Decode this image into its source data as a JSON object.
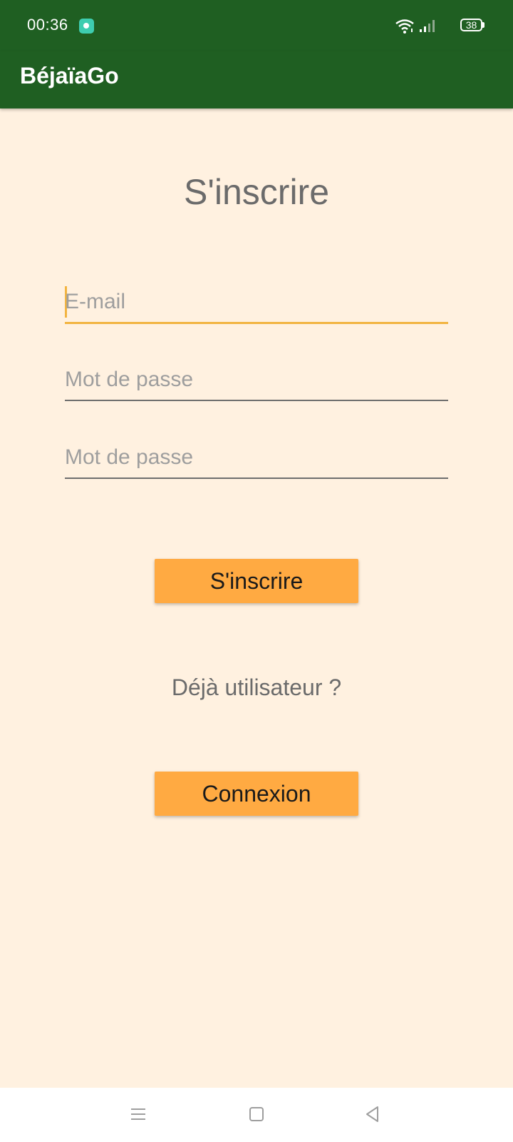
{
  "status_bar": {
    "time": "00:36",
    "battery": "38",
    "icons": [
      "app-notification-icon",
      "wifi-icon",
      "signal-icon",
      "battery-icon"
    ]
  },
  "app_bar": {
    "title": "BéjaïaGo"
  },
  "form": {
    "title": "S'inscrire",
    "email_placeholder": "E-mail",
    "password_placeholder": "Mot de passe",
    "confirm_password_placeholder": "Mot de passe",
    "register_button": "S'inscrire",
    "already_user_text": "Déjà utilisateur ?",
    "login_button": "Connexion"
  },
  "nav_bar": {
    "icons": [
      "menu-icon",
      "home-icon",
      "back-icon"
    ]
  },
  "colors": {
    "app_bar": "#1F5F22",
    "background": "#FFF1E0",
    "button": "#FFAA42",
    "focus_accent": "#F2B440",
    "muted_text": "#6B6B6B"
  }
}
